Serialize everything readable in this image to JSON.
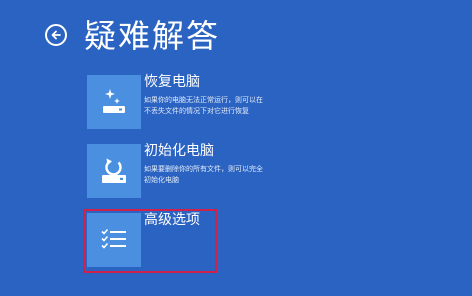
{
  "header": {
    "title": "疑难解答",
    "back_icon": "back-arrow-icon"
  },
  "options": [
    {
      "title": "恢复电脑",
      "description": "如果你的电脑无法正常运行，则可以在不丢失文件的情况下对它进行恢复",
      "icon": "sparkle-drive-icon"
    },
    {
      "title": "初始化电脑",
      "description": "如果要删除你的所有文件，则可以完全初始化电脑",
      "icon": "refresh-drive-icon"
    },
    {
      "title": "高级选项",
      "description": "",
      "icon": "checklist-icon"
    }
  ],
  "colors": {
    "background": "#2a63c2",
    "tile": "#4b90e0",
    "highlight": "#d0214a"
  }
}
